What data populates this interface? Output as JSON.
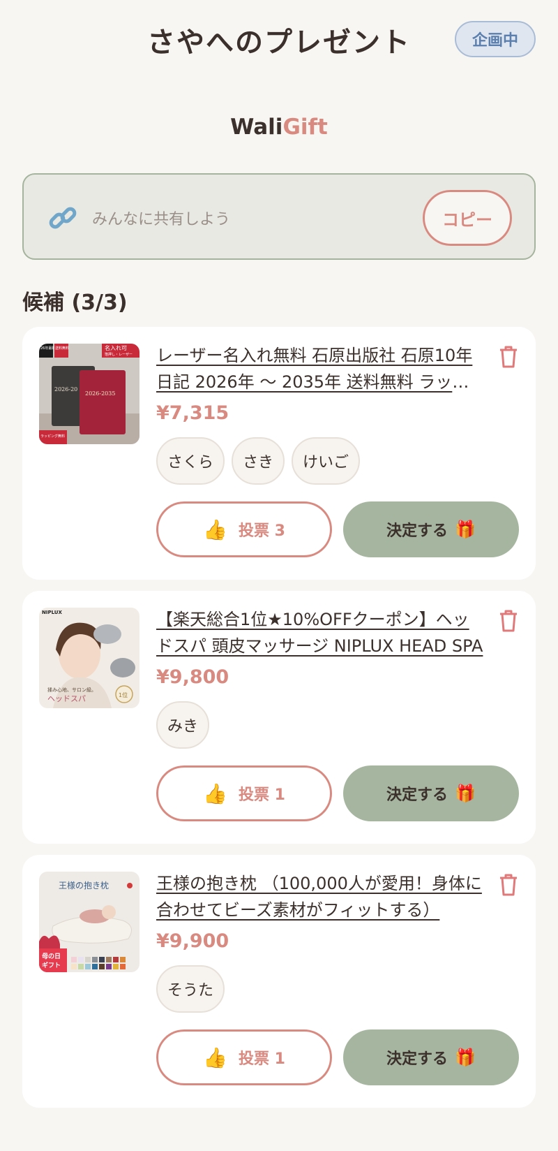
{
  "header": {
    "title": "さやへのプレゼント",
    "status_badge": "企画中"
  },
  "logo": {
    "part1": "Wali",
    "part2": "Gift"
  },
  "share": {
    "text": "みんなに共有しよう",
    "copy_label": "コピー"
  },
  "section_title": "候補 (3/3)",
  "candidates": [
    {
      "title": "レーザー名入れ無料 石原出版社 石原10年日記 2026年 〜 2035年 送料無料 ラッピング",
      "price": "¥7,315",
      "voters": [
        "さくら",
        "さき",
        "けいご"
      ],
      "vote_label": "投票 3",
      "decide_label": "決定する",
      "thumb_labels": {
        "corner_left": "26年最新版",
        "corner_mid": "送料無料",
        "corner_right": "名入れ可",
        "corner_right_sub": "箔押し・レーザー",
        "book_text": "2026-2035",
        "bottom_badge": "ラッピング無料"
      }
    },
    {
      "title": "【楽天総合1位★10%OFFクーポン】ヘッドスパ 頭皮マッサージ NIPLUX HEAD SPA",
      "price": "¥9,800",
      "voters": [
        "みき"
      ],
      "vote_label": "投票 1",
      "decide_label": "決定する",
      "thumb_labels": {
        "brand": "NIPLUX",
        "tagline": "揉み心地、サロン級。",
        "product": "ヘッドスパ",
        "rank": "1位"
      }
    },
    {
      "title": "王様の抱き枕 （100,000人が愛用！身体に合わせてビーズ素材がフィットする）",
      "price": "¥9,900",
      "voters": [
        "そうた"
      ],
      "vote_label": "投票 1",
      "decide_label": "決定する",
      "thumb_labels": {
        "heading": "王様の抱き枕",
        "badge_line1": "母の日",
        "badge_line2": "ギフト"
      }
    }
  ],
  "icons": {
    "link": "link-icon",
    "delete": "trash-icon",
    "vote": "thumbs-up-icon",
    "decide": "gift-icon"
  },
  "colors": {
    "accent": "#d98a80",
    "sage": "#a6b59f",
    "background": "#f8f6f2",
    "badge_bg": "#dfe6ef",
    "badge_text": "#5a7fae"
  }
}
